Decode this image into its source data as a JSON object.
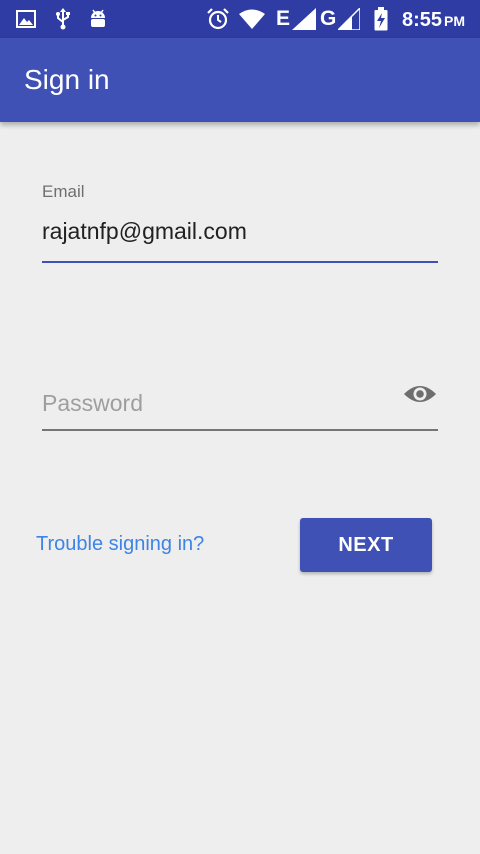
{
  "status_bar": {
    "icons": [
      "gallery-icon",
      "usb-icon",
      "android-debug-icon",
      "alarm-icon",
      "wifi-icon",
      "signal-icon",
      "signal-icon",
      "battery-charging-icon"
    ],
    "network_e": "E",
    "network_g": "G",
    "time": "8:55",
    "ampm": "PM"
  },
  "app_bar": {
    "title": "Sign in",
    "color": "#3f51b5"
  },
  "form": {
    "email_label": "Email",
    "email_value": "rajatnfp@gmail.com",
    "password_placeholder": "Password",
    "password_value": "",
    "toggle_icon": "eye-icon"
  },
  "actions": {
    "trouble_label": "Trouble signing in?",
    "next_label": "NEXT"
  },
  "colors": {
    "status_bar": "#2f3ca3",
    "primary": "#3f51b5",
    "link": "#3d84e6",
    "background": "#eeeeee"
  }
}
